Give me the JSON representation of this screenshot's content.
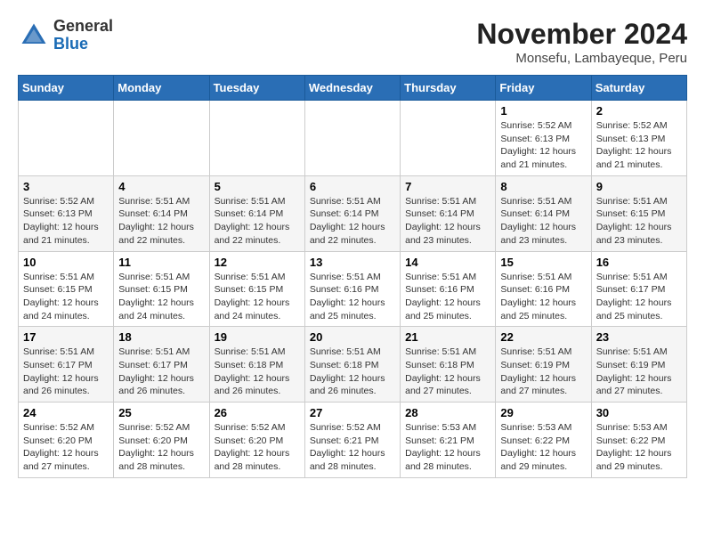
{
  "logo": {
    "general": "General",
    "blue": "Blue"
  },
  "title": {
    "month_year": "November 2024",
    "location": "Monsefu, Lambayeque, Peru"
  },
  "headers": [
    "Sunday",
    "Monday",
    "Tuesday",
    "Wednesday",
    "Thursday",
    "Friday",
    "Saturday"
  ],
  "weeks": [
    [
      {
        "day": "",
        "info": ""
      },
      {
        "day": "",
        "info": ""
      },
      {
        "day": "",
        "info": ""
      },
      {
        "day": "",
        "info": ""
      },
      {
        "day": "",
        "info": ""
      },
      {
        "day": "1",
        "info": "Sunrise: 5:52 AM\nSunset: 6:13 PM\nDaylight: 12 hours\nand 21 minutes."
      },
      {
        "day": "2",
        "info": "Sunrise: 5:52 AM\nSunset: 6:13 PM\nDaylight: 12 hours\nand 21 minutes."
      }
    ],
    [
      {
        "day": "3",
        "info": "Sunrise: 5:52 AM\nSunset: 6:13 PM\nDaylight: 12 hours\nand 21 minutes."
      },
      {
        "day": "4",
        "info": "Sunrise: 5:51 AM\nSunset: 6:14 PM\nDaylight: 12 hours\nand 22 minutes."
      },
      {
        "day": "5",
        "info": "Sunrise: 5:51 AM\nSunset: 6:14 PM\nDaylight: 12 hours\nand 22 minutes."
      },
      {
        "day": "6",
        "info": "Sunrise: 5:51 AM\nSunset: 6:14 PM\nDaylight: 12 hours\nand 22 minutes."
      },
      {
        "day": "7",
        "info": "Sunrise: 5:51 AM\nSunset: 6:14 PM\nDaylight: 12 hours\nand 23 minutes."
      },
      {
        "day": "8",
        "info": "Sunrise: 5:51 AM\nSunset: 6:14 PM\nDaylight: 12 hours\nand 23 minutes."
      },
      {
        "day": "9",
        "info": "Sunrise: 5:51 AM\nSunset: 6:15 PM\nDaylight: 12 hours\nand 23 minutes."
      }
    ],
    [
      {
        "day": "10",
        "info": "Sunrise: 5:51 AM\nSunset: 6:15 PM\nDaylight: 12 hours\nand 24 minutes."
      },
      {
        "day": "11",
        "info": "Sunrise: 5:51 AM\nSunset: 6:15 PM\nDaylight: 12 hours\nand 24 minutes."
      },
      {
        "day": "12",
        "info": "Sunrise: 5:51 AM\nSunset: 6:15 PM\nDaylight: 12 hours\nand 24 minutes."
      },
      {
        "day": "13",
        "info": "Sunrise: 5:51 AM\nSunset: 6:16 PM\nDaylight: 12 hours\nand 25 minutes."
      },
      {
        "day": "14",
        "info": "Sunrise: 5:51 AM\nSunset: 6:16 PM\nDaylight: 12 hours\nand 25 minutes."
      },
      {
        "day": "15",
        "info": "Sunrise: 5:51 AM\nSunset: 6:16 PM\nDaylight: 12 hours\nand 25 minutes."
      },
      {
        "day": "16",
        "info": "Sunrise: 5:51 AM\nSunset: 6:17 PM\nDaylight: 12 hours\nand 25 minutes."
      }
    ],
    [
      {
        "day": "17",
        "info": "Sunrise: 5:51 AM\nSunset: 6:17 PM\nDaylight: 12 hours\nand 26 minutes."
      },
      {
        "day": "18",
        "info": "Sunrise: 5:51 AM\nSunset: 6:17 PM\nDaylight: 12 hours\nand 26 minutes."
      },
      {
        "day": "19",
        "info": "Sunrise: 5:51 AM\nSunset: 6:18 PM\nDaylight: 12 hours\nand 26 minutes."
      },
      {
        "day": "20",
        "info": "Sunrise: 5:51 AM\nSunset: 6:18 PM\nDaylight: 12 hours\nand 26 minutes."
      },
      {
        "day": "21",
        "info": "Sunrise: 5:51 AM\nSunset: 6:18 PM\nDaylight: 12 hours\nand 27 minutes."
      },
      {
        "day": "22",
        "info": "Sunrise: 5:51 AM\nSunset: 6:19 PM\nDaylight: 12 hours\nand 27 minutes."
      },
      {
        "day": "23",
        "info": "Sunrise: 5:51 AM\nSunset: 6:19 PM\nDaylight: 12 hours\nand 27 minutes."
      }
    ],
    [
      {
        "day": "24",
        "info": "Sunrise: 5:52 AM\nSunset: 6:20 PM\nDaylight: 12 hours\nand 27 minutes."
      },
      {
        "day": "25",
        "info": "Sunrise: 5:52 AM\nSunset: 6:20 PM\nDaylight: 12 hours\nand 28 minutes."
      },
      {
        "day": "26",
        "info": "Sunrise: 5:52 AM\nSunset: 6:20 PM\nDaylight: 12 hours\nand 28 minutes."
      },
      {
        "day": "27",
        "info": "Sunrise: 5:52 AM\nSunset: 6:21 PM\nDaylight: 12 hours\nand 28 minutes."
      },
      {
        "day": "28",
        "info": "Sunrise: 5:53 AM\nSunset: 6:21 PM\nDaylight: 12 hours\nand 28 minutes."
      },
      {
        "day": "29",
        "info": "Sunrise: 5:53 AM\nSunset: 6:22 PM\nDaylight: 12 hours\nand 29 minutes."
      },
      {
        "day": "30",
        "info": "Sunrise: 5:53 AM\nSunset: 6:22 PM\nDaylight: 12 hours\nand 29 minutes."
      }
    ]
  ]
}
